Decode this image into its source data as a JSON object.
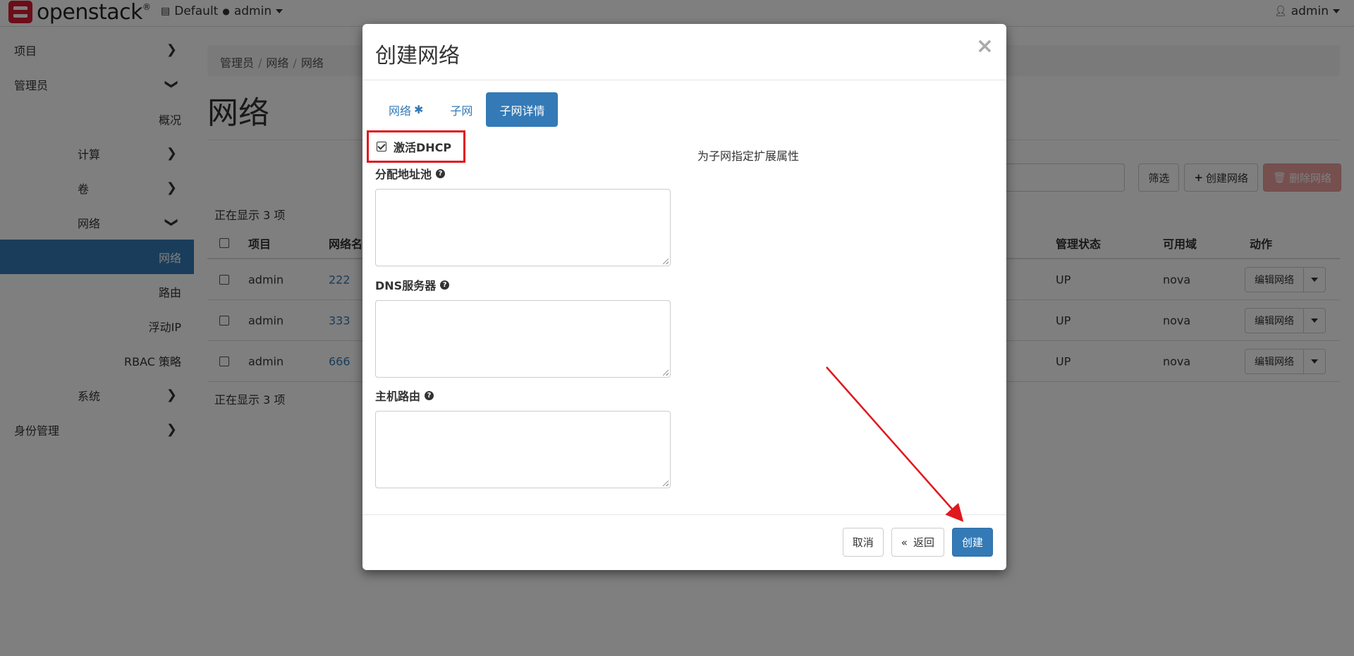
{
  "topbar": {
    "brand": "openstack",
    "brand_mark": "®",
    "domain": "Default",
    "project": "admin",
    "user": "admin"
  },
  "sidebar": {
    "items": [
      {
        "label": "项目",
        "level": 0,
        "chevron": "right"
      },
      {
        "label": "管理员",
        "level": 0,
        "chevron": "down"
      },
      {
        "label": "概况",
        "level": 2
      },
      {
        "label": "计算",
        "level": 1,
        "chevron": "right"
      },
      {
        "label": "卷",
        "level": 1,
        "chevron": "right"
      },
      {
        "label": "网络",
        "level": 1,
        "chevron": "down"
      },
      {
        "label": "网络",
        "level": 2,
        "active": true
      },
      {
        "label": "路由",
        "level": 2
      },
      {
        "label": "浮动IP",
        "level": 2
      },
      {
        "label": "RBAC 策略",
        "level": 2
      },
      {
        "label": "系统",
        "level": 1,
        "chevron": "right"
      },
      {
        "label": "身份管理",
        "level": 0,
        "chevron": "right"
      }
    ]
  },
  "breadcrumb": [
    "管理员",
    "网络",
    "网络"
  ],
  "page_title": "网络",
  "toolbar": {
    "filter": "筛选",
    "create": "创建网络",
    "delete": "删除网络"
  },
  "table": {
    "count_top": "正在显示 3 项",
    "count_bottom": "正在显示 3 项",
    "headers": {
      "project": "项目",
      "name": "网络名",
      "admin_state": "管理状态",
      "az": "可用域",
      "actions": "动作"
    },
    "rows": [
      {
        "project": "admin",
        "name": "222",
        "admin_state": "UP",
        "az": "nova",
        "action": "编辑网络"
      },
      {
        "project": "admin",
        "name": "333",
        "admin_state": "UP",
        "az": "nova",
        "action": "编辑网络"
      },
      {
        "project": "admin",
        "name": "666",
        "admin_state": "UP",
        "az": "nova",
        "action": "编辑网络"
      }
    ]
  },
  "modal": {
    "title": "创建网络",
    "close": "×",
    "tabs": [
      {
        "label": "网络",
        "required": "✱"
      },
      {
        "label": "子网"
      },
      {
        "label": "子网详情",
        "active": true
      }
    ],
    "dhcp_label": "激活DHCP",
    "dhcp_checked": true,
    "fields": {
      "pools_label": "分配地址池",
      "dns_label": "DNS服务器",
      "routes_label": "主机路由"
    },
    "help_text": "为子网指定扩展属性",
    "buttons": {
      "cancel": "取消",
      "back": "返回",
      "back_icon": "«",
      "create": "创建"
    }
  },
  "annotation": {
    "color": "#e0171d"
  }
}
